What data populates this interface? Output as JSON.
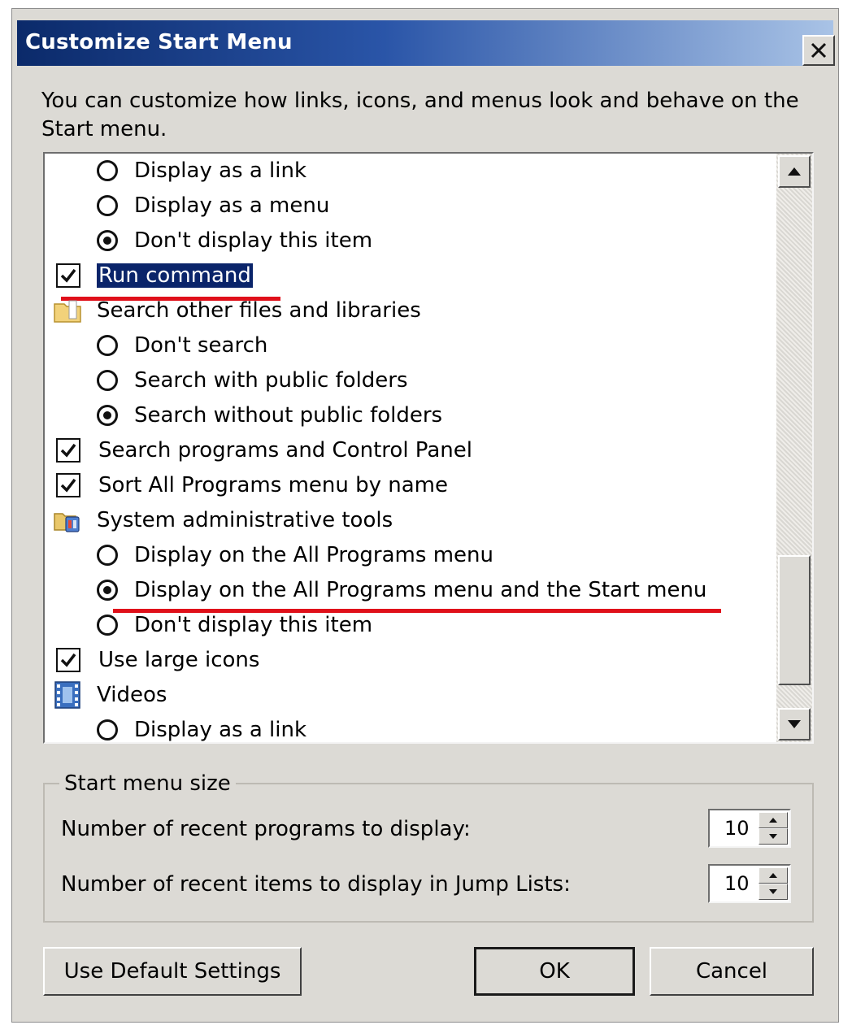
{
  "window": {
    "title": "Customize Start Menu",
    "close_glyph": "✕"
  },
  "intro_text": "You can customize how links, icons, and menus look and behave on the Start menu.",
  "options_list": {
    "items": [
      {
        "kind": "radio",
        "label": "Display as a link",
        "selected": false
      },
      {
        "kind": "radio",
        "label": "Display as a menu",
        "selected": false
      },
      {
        "kind": "radio",
        "label": "Don't display this item",
        "selected": true
      },
      {
        "kind": "checkbox",
        "label": "Run command",
        "checked": true,
        "highlighted": true
      },
      {
        "kind": "group",
        "label": "Search other files and libraries",
        "icon": "folder-icon"
      },
      {
        "kind": "radio",
        "label": "Don't search",
        "selected": false
      },
      {
        "kind": "radio",
        "label": "Search with public folders",
        "selected": false
      },
      {
        "kind": "radio",
        "label": "Search without public folders",
        "selected": true
      },
      {
        "kind": "checkbox",
        "label": "Search programs and Control Panel",
        "checked": true
      },
      {
        "kind": "checkbox",
        "label": "Sort All Programs menu by name",
        "checked": true
      },
      {
        "kind": "group",
        "label": "System administrative tools",
        "icon": "admin-tools-icon"
      },
      {
        "kind": "radio",
        "label": "Display on the All Programs menu",
        "selected": false
      },
      {
        "kind": "radio",
        "label": "Display on the All Programs menu and the Start menu",
        "selected": true
      },
      {
        "kind": "radio",
        "label": "Don't display this item",
        "selected": false
      },
      {
        "kind": "checkbox",
        "label": "Use large icons",
        "checked": true
      },
      {
        "kind": "group",
        "label": "Videos",
        "icon": "videos-icon"
      },
      {
        "kind": "radio",
        "label": "Display as a link",
        "selected": false
      }
    ],
    "annotation_color": "#e0101a"
  },
  "start_menu_size": {
    "legend": "Start menu size",
    "recent_programs_label": "Number of recent programs to display:",
    "recent_programs_value": "10",
    "jump_list_label": "Number of recent items to display in Jump Lists:",
    "jump_list_value": "10"
  },
  "buttons": {
    "defaults_label": "Use Default Settings",
    "ok_label": "OK",
    "cancel_label": "Cancel"
  },
  "colors": {
    "title_gradient_start": "#0b2a6a",
    "title_gradient_end": "#a9c3e6",
    "dialog_face": "#dcdad5",
    "selection": "#0a246a"
  }
}
